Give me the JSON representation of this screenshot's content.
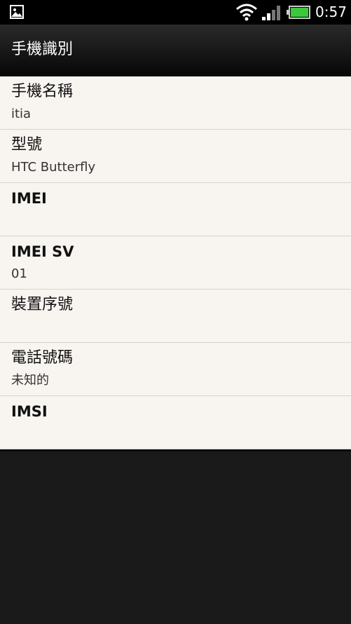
{
  "status_bar": {
    "time": "0:57",
    "icons": [
      "image-notification-icon",
      "wifi-icon",
      "signal-icon",
      "battery-icon"
    ],
    "battery_color": "#3cc83c"
  },
  "header": {
    "title": "手機識別"
  },
  "items": [
    {
      "label": "手機名稱",
      "value": "itia"
    },
    {
      "label": "型號",
      "value": "HTC Butterfly"
    },
    {
      "label": "IMEI",
      "value": ""
    },
    {
      "label": "IMEI SV",
      "value": "01"
    },
    {
      "label": "裝置序號",
      "value": ""
    },
    {
      "label": "電話號碼",
      "value": "未知的"
    },
    {
      "label": "IMSI",
      "value": ""
    }
  ]
}
